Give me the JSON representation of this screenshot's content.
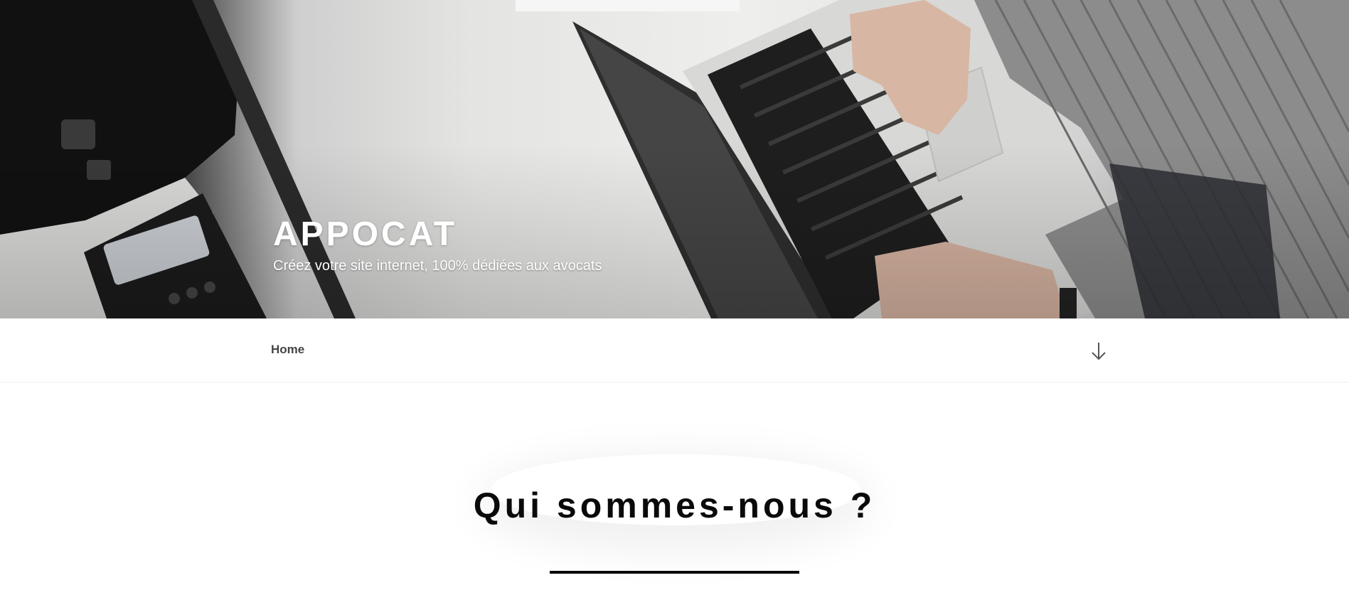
{
  "header": {
    "site_title": "APPOCAT",
    "tagline": "Créez votre site internet, 100% dédiées aux avocats",
    "hero_image": "desk-laptop-phone-photo"
  },
  "nav": {
    "items": [
      {
        "label": "Home"
      }
    ],
    "scroll_icon": "arrow-down-icon"
  },
  "main": {
    "section_heading": "Qui sommes-nous ?"
  },
  "colors": {
    "text_dark": "#0a0a0a",
    "nav_text": "#444444",
    "rule": "#000000",
    "background": "#ffffff"
  }
}
